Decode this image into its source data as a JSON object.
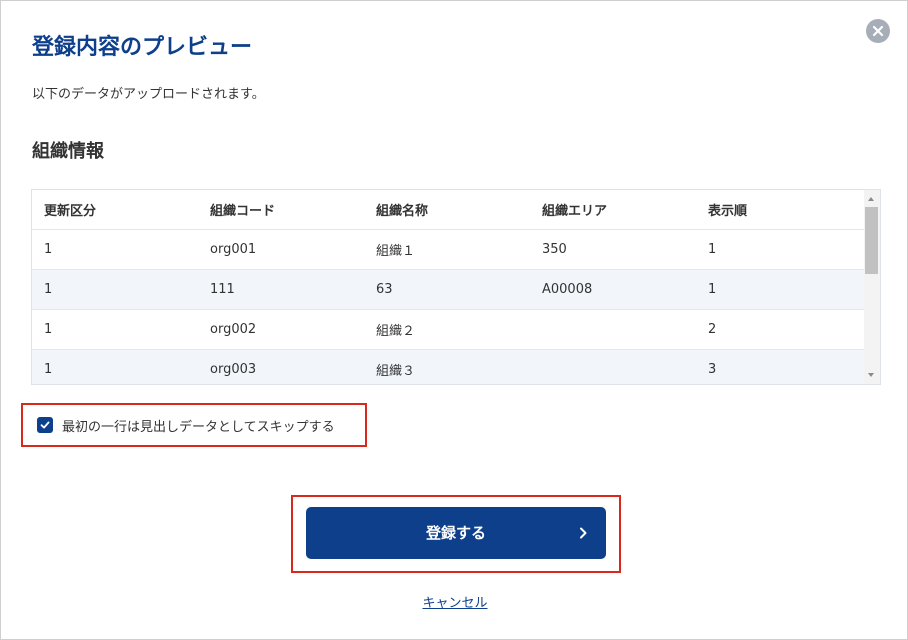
{
  "dialog": {
    "title": "登録内容のプレビュー",
    "description": "以下のデータがアップロードされます。",
    "close_icon": "close-circle-icon"
  },
  "section": {
    "title": "組織情報"
  },
  "table": {
    "headers": [
      "更新区分",
      "組織コード",
      "組織名称",
      "組織エリア",
      "表示順"
    ],
    "rows": [
      [
        "1",
        "org001",
        "組織１",
        "350",
        "1"
      ],
      [
        "1",
        "111",
        "63",
        "A00008",
        "1"
      ],
      [
        "1",
        "org002",
        "組織２",
        "",
        "2"
      ],
      [
        "1",
        "org003",
        "組織３",
        "",
        "3"
      ]
    ]
  },
  "skip_header": {
    "label": "最初の一行は見出しデータとしてスキップする",
    "checked": true
  },
  "actions": {
    "submit_label": "登録する",
    "cancel_label": "キャンセル"
  },
  "colors": {
    "primary": "#0d3f8a",
    "highlight_border": "#d9281c",
    "row_alt": "#f2f6fb"
  }
}
